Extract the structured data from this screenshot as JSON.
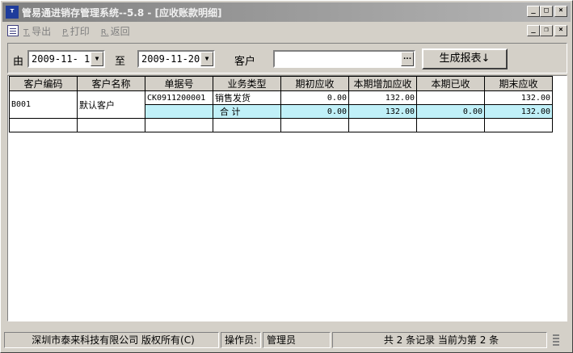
{
  "window": {
    "title": "管易通进销存管理系统--5.8 - [应收账款明细]",
    "controls": {
      "minimize": "_",
      "maximize": "□",
      "close": "×"
    },
    "mdi_controls": {
      "minimize": "_",
      "restore": "❐",
      "close": "×"
    }
  },
  "menu": {
    "export": {
      "key": "T.",
      "label": "导出"
    },
    "print": {
      "key": "P.",
      "label": "打印"
    },
    "back": {
      "key": "R.",
      "label": "返回"
    }
  },
  "toolbar": {
    "from_label": "由",
    "from_date": "2009-11- 1",
    "to_label": "至",
    "to_date": "2009-11-20",
    "customer_label": "客户",
    "customer_value": "",
    "browse_label": "...",
    "generate_label": "生成报表↓"
  },
  "table": {
    "headers": [
      "客户编码",
      "客户名称",
      "单据号",
      "业务类型",
      "期初应收",
      "本期增加应收",
      "本期已收",
      "期末应收"
    ],
    "rows": [
      {
        "code": "B001",
        "name": "默认客户",
        "doc": "CK0911200001",
        "type": "销售发货",
        "opening": "0.00",
        "increase": "132.00",
        "received": "",
        "closing": "132.00"
      },
      {
        "type": "合  计",
        "opening": "0.00",
        "increase": "132.00",
        "received": "0.00",
        "closing": "132.00"
      }
    ]
  },
  "status": {
    "company": "深圳市泰来科技有限公司 版权所有(C)",
    "operator_label": "操作员:",
    "operator": "管理员",
    "records": "共 2 条记录 当前为第 2 条"
  }
}
